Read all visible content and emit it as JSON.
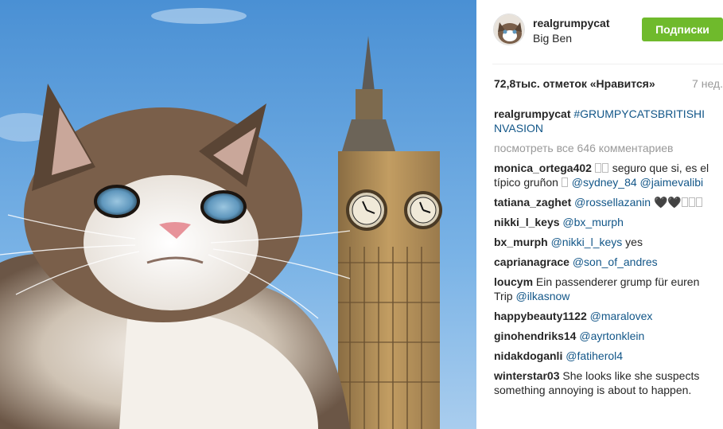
{
  "post": {
    "owner": "realgrumpycat",
    "location": "Big Ben",
    "follow_button": "Подписки",
    "likes": "72,8тыс. отметок «Нравится»",
    "time": "7 нед."
  },
  "caption": {
    "user": "realgrumpycat",
    "hashtag": "#GRUMPYCATSBRITISHINVASION"
  },
  "view_all_comments": "посмотреть все 646 комментариев",
  "comments": [
    {
      "user": "monica_ortega402",
      "pre": "",
      "glyphs_a": "",
      "text": "seguro que si, es el típico gruñon",
      "mentions": "@sydney_84 @jaimevalibi",
      "suffix": ""
    },
    {
      "user": "tatiana_zaghet",
      "text": "",
      "mentions": "@rossellazanin",
      "suffix": "🖤🖤"
    },
    {
      "user": "nikki_l_keys",
      "text": "",
      "mentions": "@bx_murph",
      "suffix": ""
    },
    {
      "user": "bx_murph",
      "text": "",
      "mentions": "@nikki_l_keys",
      "suffix": "yes"
    },
    {
      "user": "caprianagrace",
      "text": "",
      "mentions": "@son_of_andres",
      "suffix": ""
    },
    {
      "user": "loucym",
      "text": "Ein passenderer grump für euren Trip",
      "mentions": "@ilkasnow",
      "suffix": ""
    },
    {
      "user": "happybeauty1122",
      "text": "",
      "mentions": "@maralovex",
      "suffix": ""
    },
    {
      "user": "ginohendriks14",
      "text": "",
      "mentions": "@ayrtonklein",
      "suffix": ""
    },
    {
      "user": "nidakdoganli",
      "text": "",
      "mentions": "@fatiherol4",
      "suffix": ""
    },
    {
      "user": "winterstar03",
      "text": "She looks like she suspects something annoying is about to happen.",
      "mentions": "",
      "suffix": ""
    }
  ],
  "colors": {
    "follow_green": "#6fba2c",
    "link_blue": "#125688",
    "muted_gray": "#999999"
  }
}
